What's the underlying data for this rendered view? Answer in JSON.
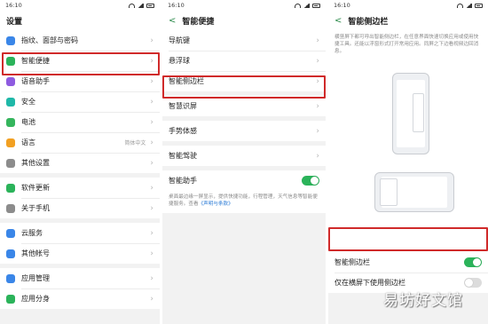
{
  "colors": {
    "accent": "#2bb35a",
    "highlight": "#d02a2a",
    "link": "#2a7bd6"
  },
  "screen1": {
    "time": "16:10",
    "title": "设置",
    "groups": [
      [
        {
          "label": "指纹、面部与密码",
          "icon": "fingerprint-icon",
          "color": "#3a86e8"
        },
        {
          "label": "智能便捷",
          "icon": "smart-convenience-icon",
          "color": "#2bb35a"
        },
        {
          "label": "语音助手",
          "icon": "voice-assistant-icon",
          "color": "#8e5be0"
        },
        {
          "label": "安全",
          "icon": "shield-icon",
          "color": "#1fb8a8"
        },
        {
          "label": "电池",
          "icon": "battery-icon",
          "color": "#35b55d"
        },
        {
          "label": "语言",
          "sub": "简体中文",
          "icon": "language-icon",
          "color": "#f2a022"
        },
        {
          "label": "其他设置",
          "icon": "gear-icon",
          "color": "#8c8c8c"
        }
      ],
      [
        {
          "label": "软件更新",
          "icon": "update-icon",
          "color": "#2bb35a"
        },
        {
          "label": "关于手机",
          "icon": "info-icon",
          "color": "#8c8c8c"
        }
      ],
      [
        {
          "label": "云服务",
          "icon": "cloud-icon",
          "color": "#3a86e8"
        },
        {
          "label": "其他帐号",
          "icon": "account-icon",
          "color": "#3a86e8"
        }
      ],
      [
        {
          "label": "应用管理",
          "icon": "app-management-icon",
          "color": "#3a86e8"
        },
        {
          "label": "应用分身",
          "icon": "app-clone-icon",
          "color": "#2bb35a"
        }
      ]
    ]
  },
  "screen2": {
    "time": "16:10",
    "title": "智能便捷",
    "groups": [
      [
        {
          "label": "导航键"
        },
        {
          "label": "悬浮球"
        },
        {
          "label": "智能侧边栏"
        }
      ],
      [
        {
          "label": "智慧识屏"
        }
      ],
      [
        {
          "label": "手势体感"
        }
      ],
      [
        {
          "label": "智能驾驶"
        }
      ]
    ],
    "assistant": {
      "label": "智能助手",
      "on": true
    },
    "note_text": "桌面最边缘一屏显示，提供快捷功能，行程管理，天气信息等智能便捷服务。查看",
    "note_link": "《声明与条款》"
  },
  "screen3": {
    "time": "16:10",
    "title": "智能侧边栏",
    "description": "横竖屏下都可呼出智能侧边栏，在任意界面快速切换应用或使用快捷工具。还能以浮窗形式打开常用应用。同屏之下边看视频边回消息。",
    "toggles": [
      {
        "label": "智能侧边栏",
        "on": true
      },
      {
        "label": "仅在横屏下使用侧边栏",
        "on": false
      }
    ]
  },
  "watermark": "易坊好文馆"
}
